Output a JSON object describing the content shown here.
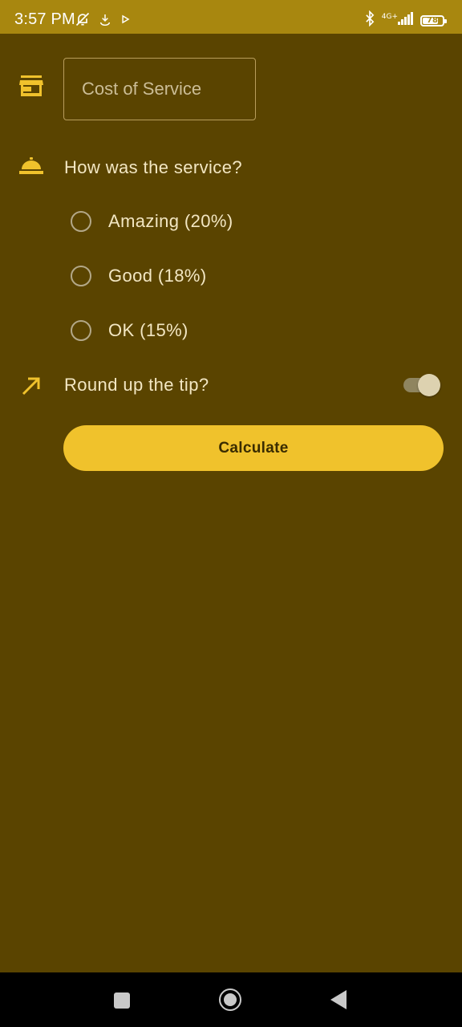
{
  "status_bar": {
    "time": "3:57 PM",
    "network": "4G+",
    "battery": "78",
    "battery_level_percent": 78,
    "left_icons": [
      "notifications-off-icon",
      "download-icon",
      "play-icon"
    ],
    "right_icons": [
      "bluetooth-icon",
      "signal-icon",
      "battery-icon"
    ]
  },
  "form": {
    "cost_placeholder": "Cost of Service",
    "cost_value": "",
    "cost_icon": "store-icon",
    "service_question": "How was the service?",
    "service_icon": "room-service-icon",
    "options": [
      {
        "label": "Amazing (20%)",
        "selected": false
      },
      {
        "label": "Good (18%)",
        "selected": false
      },
      {
        "label": "OK (15%)",
        "selected": false
      }
    ],
    "round_up_label": "Round up the tip?",
    "round_up_icon": "trending-up-icon",
    "round_up_on": true,
    "calculate_label": "Calculate"
  },
  "nav_bar": {
    "buttons": [
      "recents-button",
      "home-button",
      "back-button"
    ]
  },
  "colors": {
    "background": "#5a4400",
    "status_bar": "#a8870f",
    "accent": "#f0c22c",
    "text": "#f3e7c3"
  }
}
